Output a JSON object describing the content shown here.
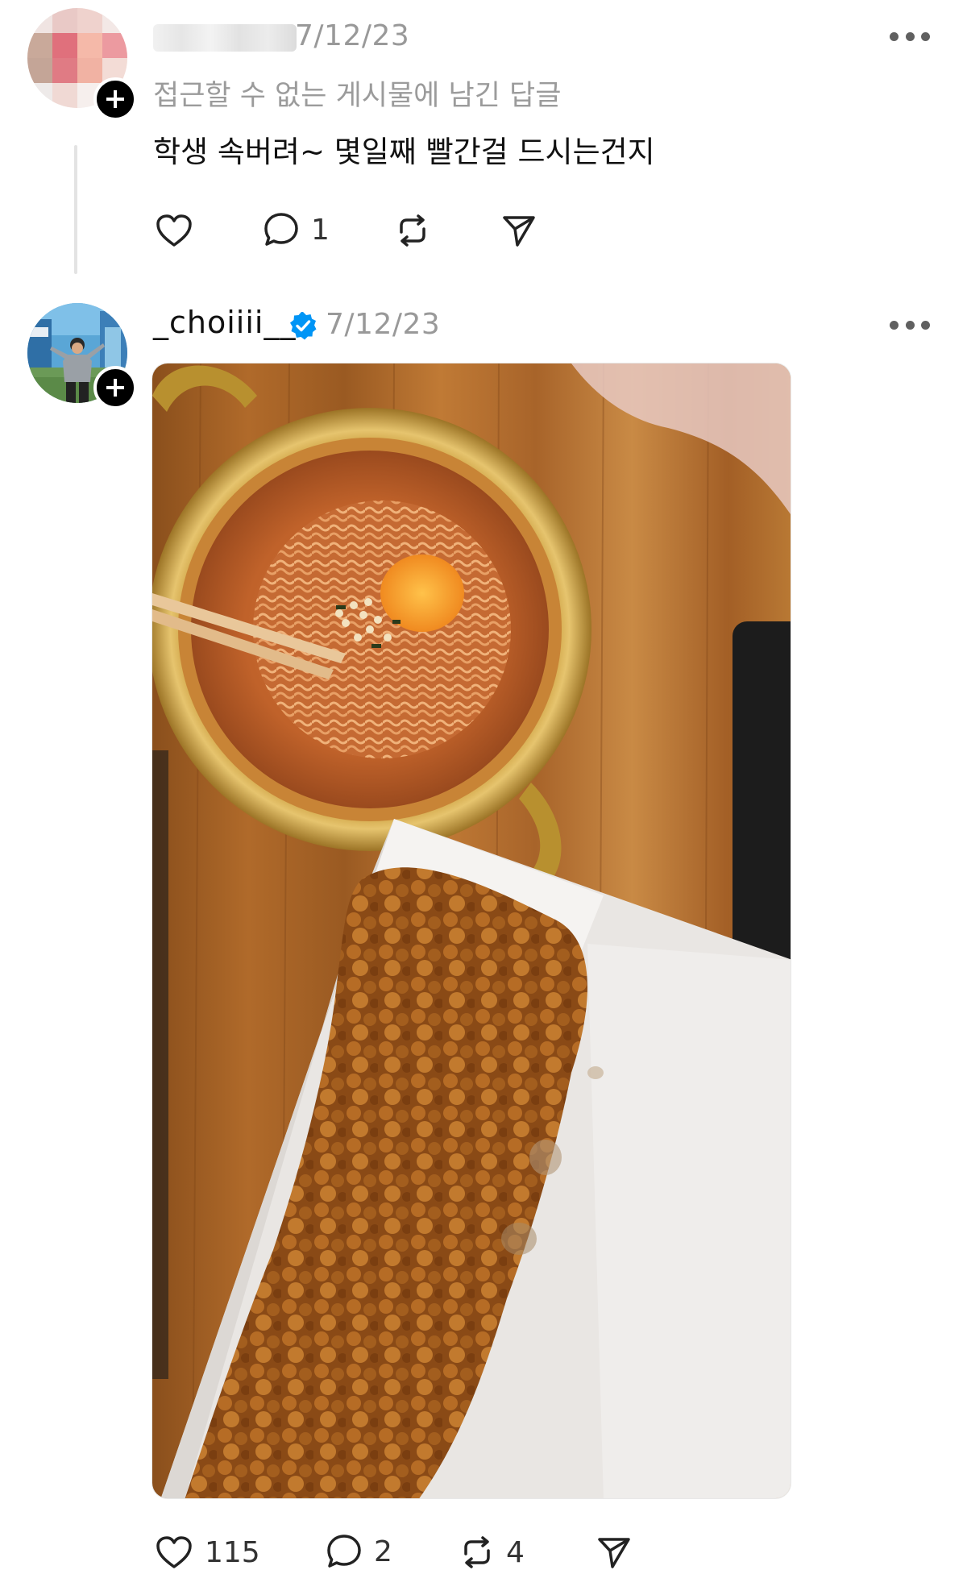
{
  "post1": {
    "date": "7/12/23",
    "context": "접근할 수 없는 게시물에 남긴 답글",
    "text": "학생 속버려~ 몇일째 빨간걸 드시는건지",
    "reply_count": "1"
  },
  "post2": {
    "username": "_choiiii__",
    "date": "7/12/23",
    "like_count": "115",
    "reply_count": "2",
    "repost_count": "4"
  },
  "icons": {
    "like": "heart-icon",
    "reply": "speech-bubble-icon",
    "repost": "repost-icon",
    "share": "send-icon",
    "more": "more-dots-icon",
    "verified": "verified-badge-icon",
    "follow": "plus-icon"
  },
  "colors": {
    "verified_blue": "#0095f6",
    "muted_text": "#999999",
    "thread_line": "#e3e3e3"
  }
}
